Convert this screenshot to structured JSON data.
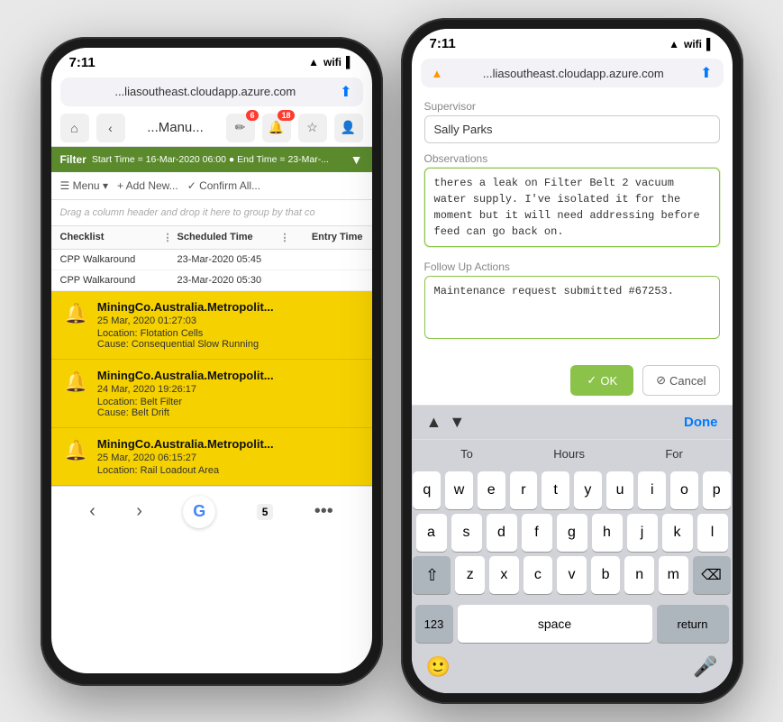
{
  "left_phone": {
    "status_bar": {
      "time": "7:11",
      "signal": "●●●",
      "wifi": "wifi",
      "battery": "🔋"
    },
    "url_bar": {
      "url": "...liasoutheast.cloudapp.azure.com",
      "share_icon": "⬆"
    },
    "toolbar": {
      "home_icon": "⌂",
      "back_icon": "‹",
      "title": "...Manu...",
      "pencil_badge": "6",
      "bell_badge": "18",
      "star_icon": "☆",
      "user_icon": "👤"
    },
    "filter_bar": {
      "label": "Filter",
      "text": "Start Time = 16-Mar-2020 06:00 ● End Time = 23-Mar-...",
      "arrow": "▼"
    },
    "action_bar": {
      "menu": "☰ Menu ▾",
      "add_new": "+ Add New...",
      "confirm_all": "✓ Confirm All..."
    },
    "drag_hint": "Drag a column header and drop it here to group by that co",
    "table_headers": {
      "checklist": "Checklist",
      "scheduled_time": "Scheduled Time",
      "entry_time": "Entry Time"
    },
    "table_rows": [
      {
        "checklist": "CPP Walkaround",
        "scheduled": "23-Mar-2020 05:45",
        "entry": ""
      },
      {
        "checklist": "CPP Walkaround",
        "scheduled": "23-Mar-2020 05:30",
        "entry": ""
      }
    ],
    "alerts": [
      {
        "title": "MiningCo.Australia.Metropolit...",
        "date": "25 Mar, 2020 01:27:03",
        "location": "Location: Flotation Cells",
        "cause": "Cause: Consequential Slow Running"
      },
      {
        "title": "MiningCo.Australia.Metropolit...",
        "date": "24 Mar, 2020 19:26:17",
        "location": "Location: Belt Filter",
        "cause": "Cause: Belt Drift"
      },
      {
        "title": "MiningCo.Australia.Metropolit...",
        "date": "25 Mar, 2020 06:15:27",
        "location": "Location: Rail Loadout Area",
        "cause": ""
      }
    ],
    "bottom_nav": {
      "back": "‹",
      "forward": "›",
      "google": "G",
      "tabs": "5",
      "more": "•••"
    }
  },
  "right_phone": {
    "status_bar": {
      "time": "7:11",
      "signal": "●●●",
      "wifi": "wifi",
      "battery": "🔋"
    },
    "url_bar": {
      "warning": "▲",
      "url": "...liasoutheast.cloudapp.azure.com",
      "share_icon": "⬆"
    },
    "form": {
      "supervisor_label": "Supervisor",
      "supervisor_value": "Sally Parks",
      "observations_label": "Observations",
      "observations_value": "theres a leak on Filter Belt 2 vacuum water supply. I've isolated it for the moment but it will need addressing before feed can go back on.",
      "followup_label": "Follow Up Actions",
      "followup_value": "Maintenance request submitted #67253."
    },
    "buttons": {
      "ok_label": "✓ OK",
      "cancel_label": "⊘ Cancel"
    },
    "keyboard_nav": {
      "up_arrow": "▲",
      "down_arrow": "▼",
      "done": "Done"
    },
    "keyboard_toolbar": {
      "to": "To",
      "hours": "Hours",
      "for": "For"
    },
    "keyboard_rows": [
      [
        "q",
        "w",
        "e",
        "r",
        "t",
        "y",
        "u",
        "i",
        "o",
        "p"
      ],
      [
        "a",
        "s",
        "d",
        "f",
        "g",
        "h",
        "j",
        "k",
        "l"
      ],
      [
        "z",
        "x",
        "c",
        "v",
        "b",
        "n",
        "m"
      ]
    ],
    "keyboard_bottom": {
      "num": "123",
      "space": "space",
      "return": "return"
    }
  }
}
